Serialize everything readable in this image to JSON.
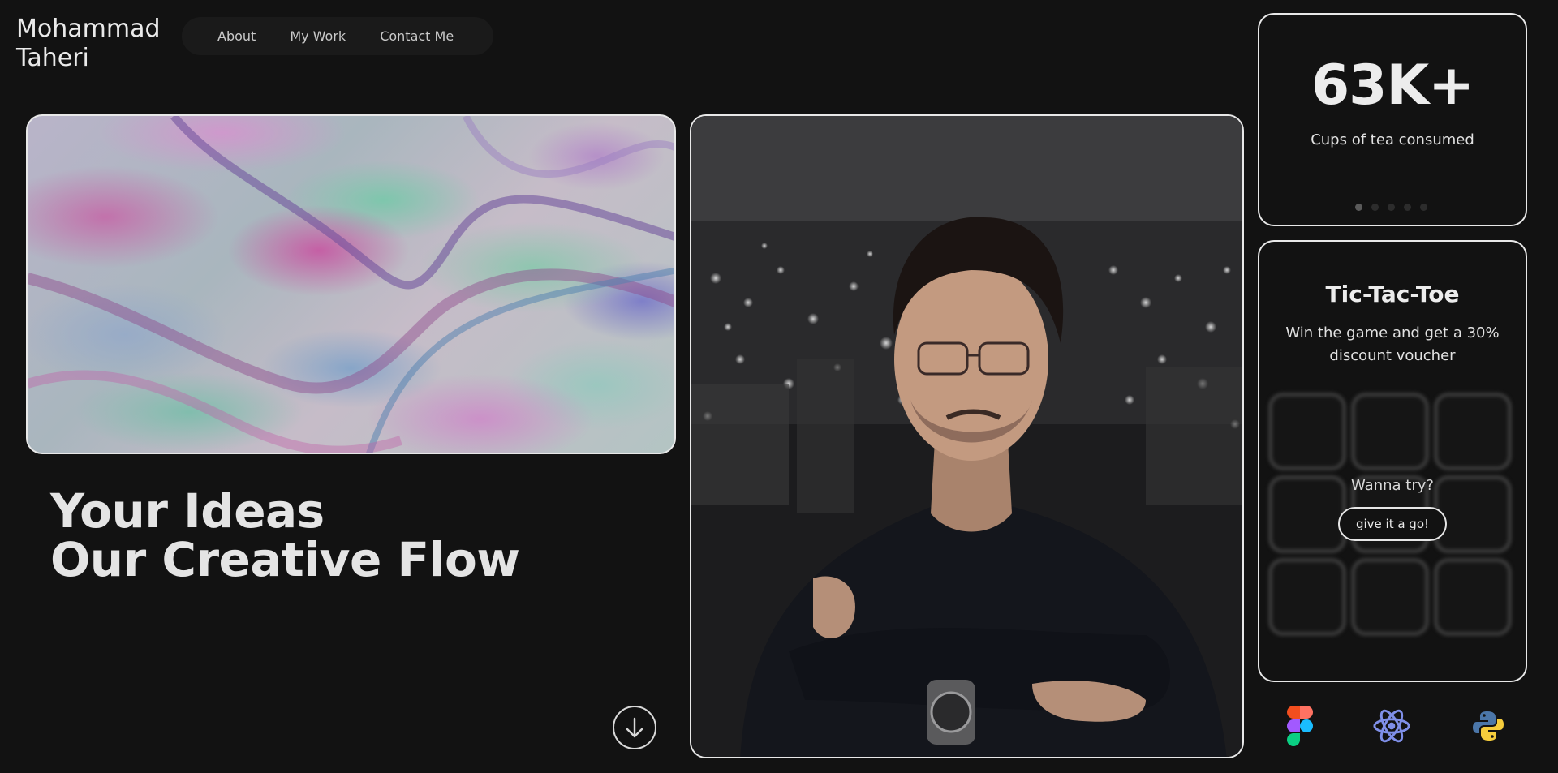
{
  "brand": {
    "line1": "Mohammad",
    "line2": "Taheri"
  },
  "nav": {
    "items": [
      {
        "label": "About"
      },
      {
        "label": "My Work"
      },
      {
        "label": "Contact Me"
      }
    ]
  },
  "hero": {
    "headline_line1": "Your Ideas",
    "headline_line2": "Our Creative Flow",
    "scroll_icon": "arrow-down-circle-icon"
  },
  "stats": {
    "value": "63K+",
    "label": "Cups of tea consumed",
    "pager": {
      "count": 5,
      "active_index": 0
    }
  },
  "game": {
    "title": "Tic-Tac-Toe",
    "description": "Win the game and get a 30% discount voucher",
    "prompt": "Wanna try?",
    "button_label": "give it a go!"
  },
  "tech_icons": [
    "figma-icon",
    "react-icon",
    "python-icon"
  ],
  "colors": {
    "background": "#121212",
    "card_border": "#e8e8e8",
    "nav_pill": "#1a1a1a",
    "text": "#e6e6e6"
  }
}
